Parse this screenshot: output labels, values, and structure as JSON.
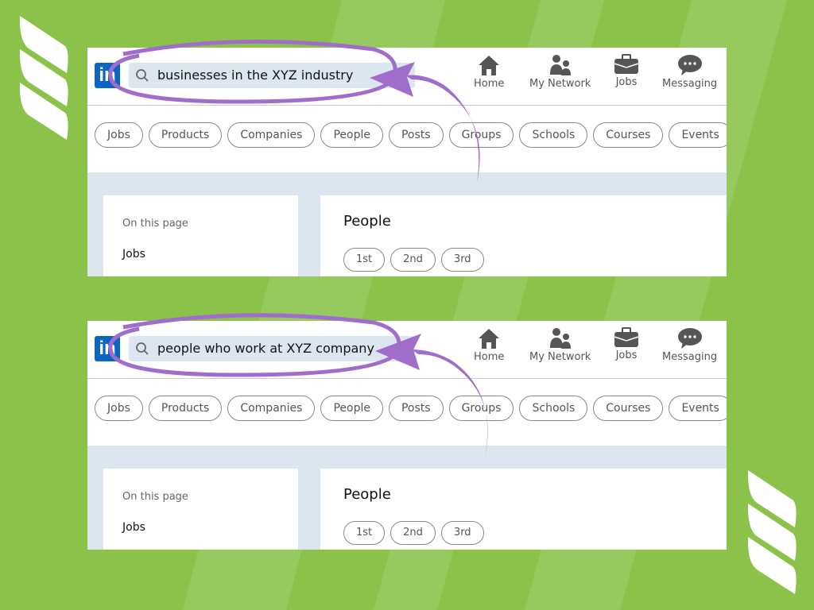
{
  "colors": {
    "background": "#8bc34a",
    "accent": "#a06dcb",
    "linkedin_blue": "#0a66c2"
  },
  "screens": [
    {
      "logo": "in",
      "search_query": "businesses in the XYZ industry",
      "nav": [
        {
          "label": "Home",
          "icon": "home-icon"
        },
        {
          "label": "My Network",
          "icon": "network-icon"
        },
        {
          "label": "Jobs",
          "icon": "briefcase-icon"
        },
        {
          "label": "Messaging",
          "icon": "messaging-icon"
        }
      ],
      "filters": [
        "Jobs",
        "Products",
        "Companies",
        "People",
        "Posts",
        "Groups",
        "Schools",
        "Courses",
        "Events"
      ],
      "sidebar": {
        "heading": "On this page",
        "items": [
          "Jobs"
        ]
      },
      "results": {
        "title": "People",
        "degrees": [
          "1st",
          "2nd",
          "3rd"
        ]
      }
    },
    {
      "logo": "in",
      "search_query": "people who work at XYZ company",
      "nav": [
        {
          "label": "Home",
          "icon": "home-icon"
        },
        {
          "label": "My Network",
          "icon": "network-icon"
        },
        {
          "label": "Jobs",
          "icon": "briefcase-icon"
        },
        {
          "label": "Messaging",
          "icon": "messaging-icon"
        }
      ],
      "filters": [
        "Jobs",
        "Products",
        "Companies",
        "People",
        "Posts",
        "Groups",
        "Schools",
        "Courses",
        "Events"
      ],
      "sidebar": {
        "heading": "On this page",
        "items": [
          "Jobs"
        ]
      },
      "results": {
        "title": "People",
        "degrees": [
          "1st",
          "2nd",
          "3rd"
        ]
      }
    }
  ]
}
